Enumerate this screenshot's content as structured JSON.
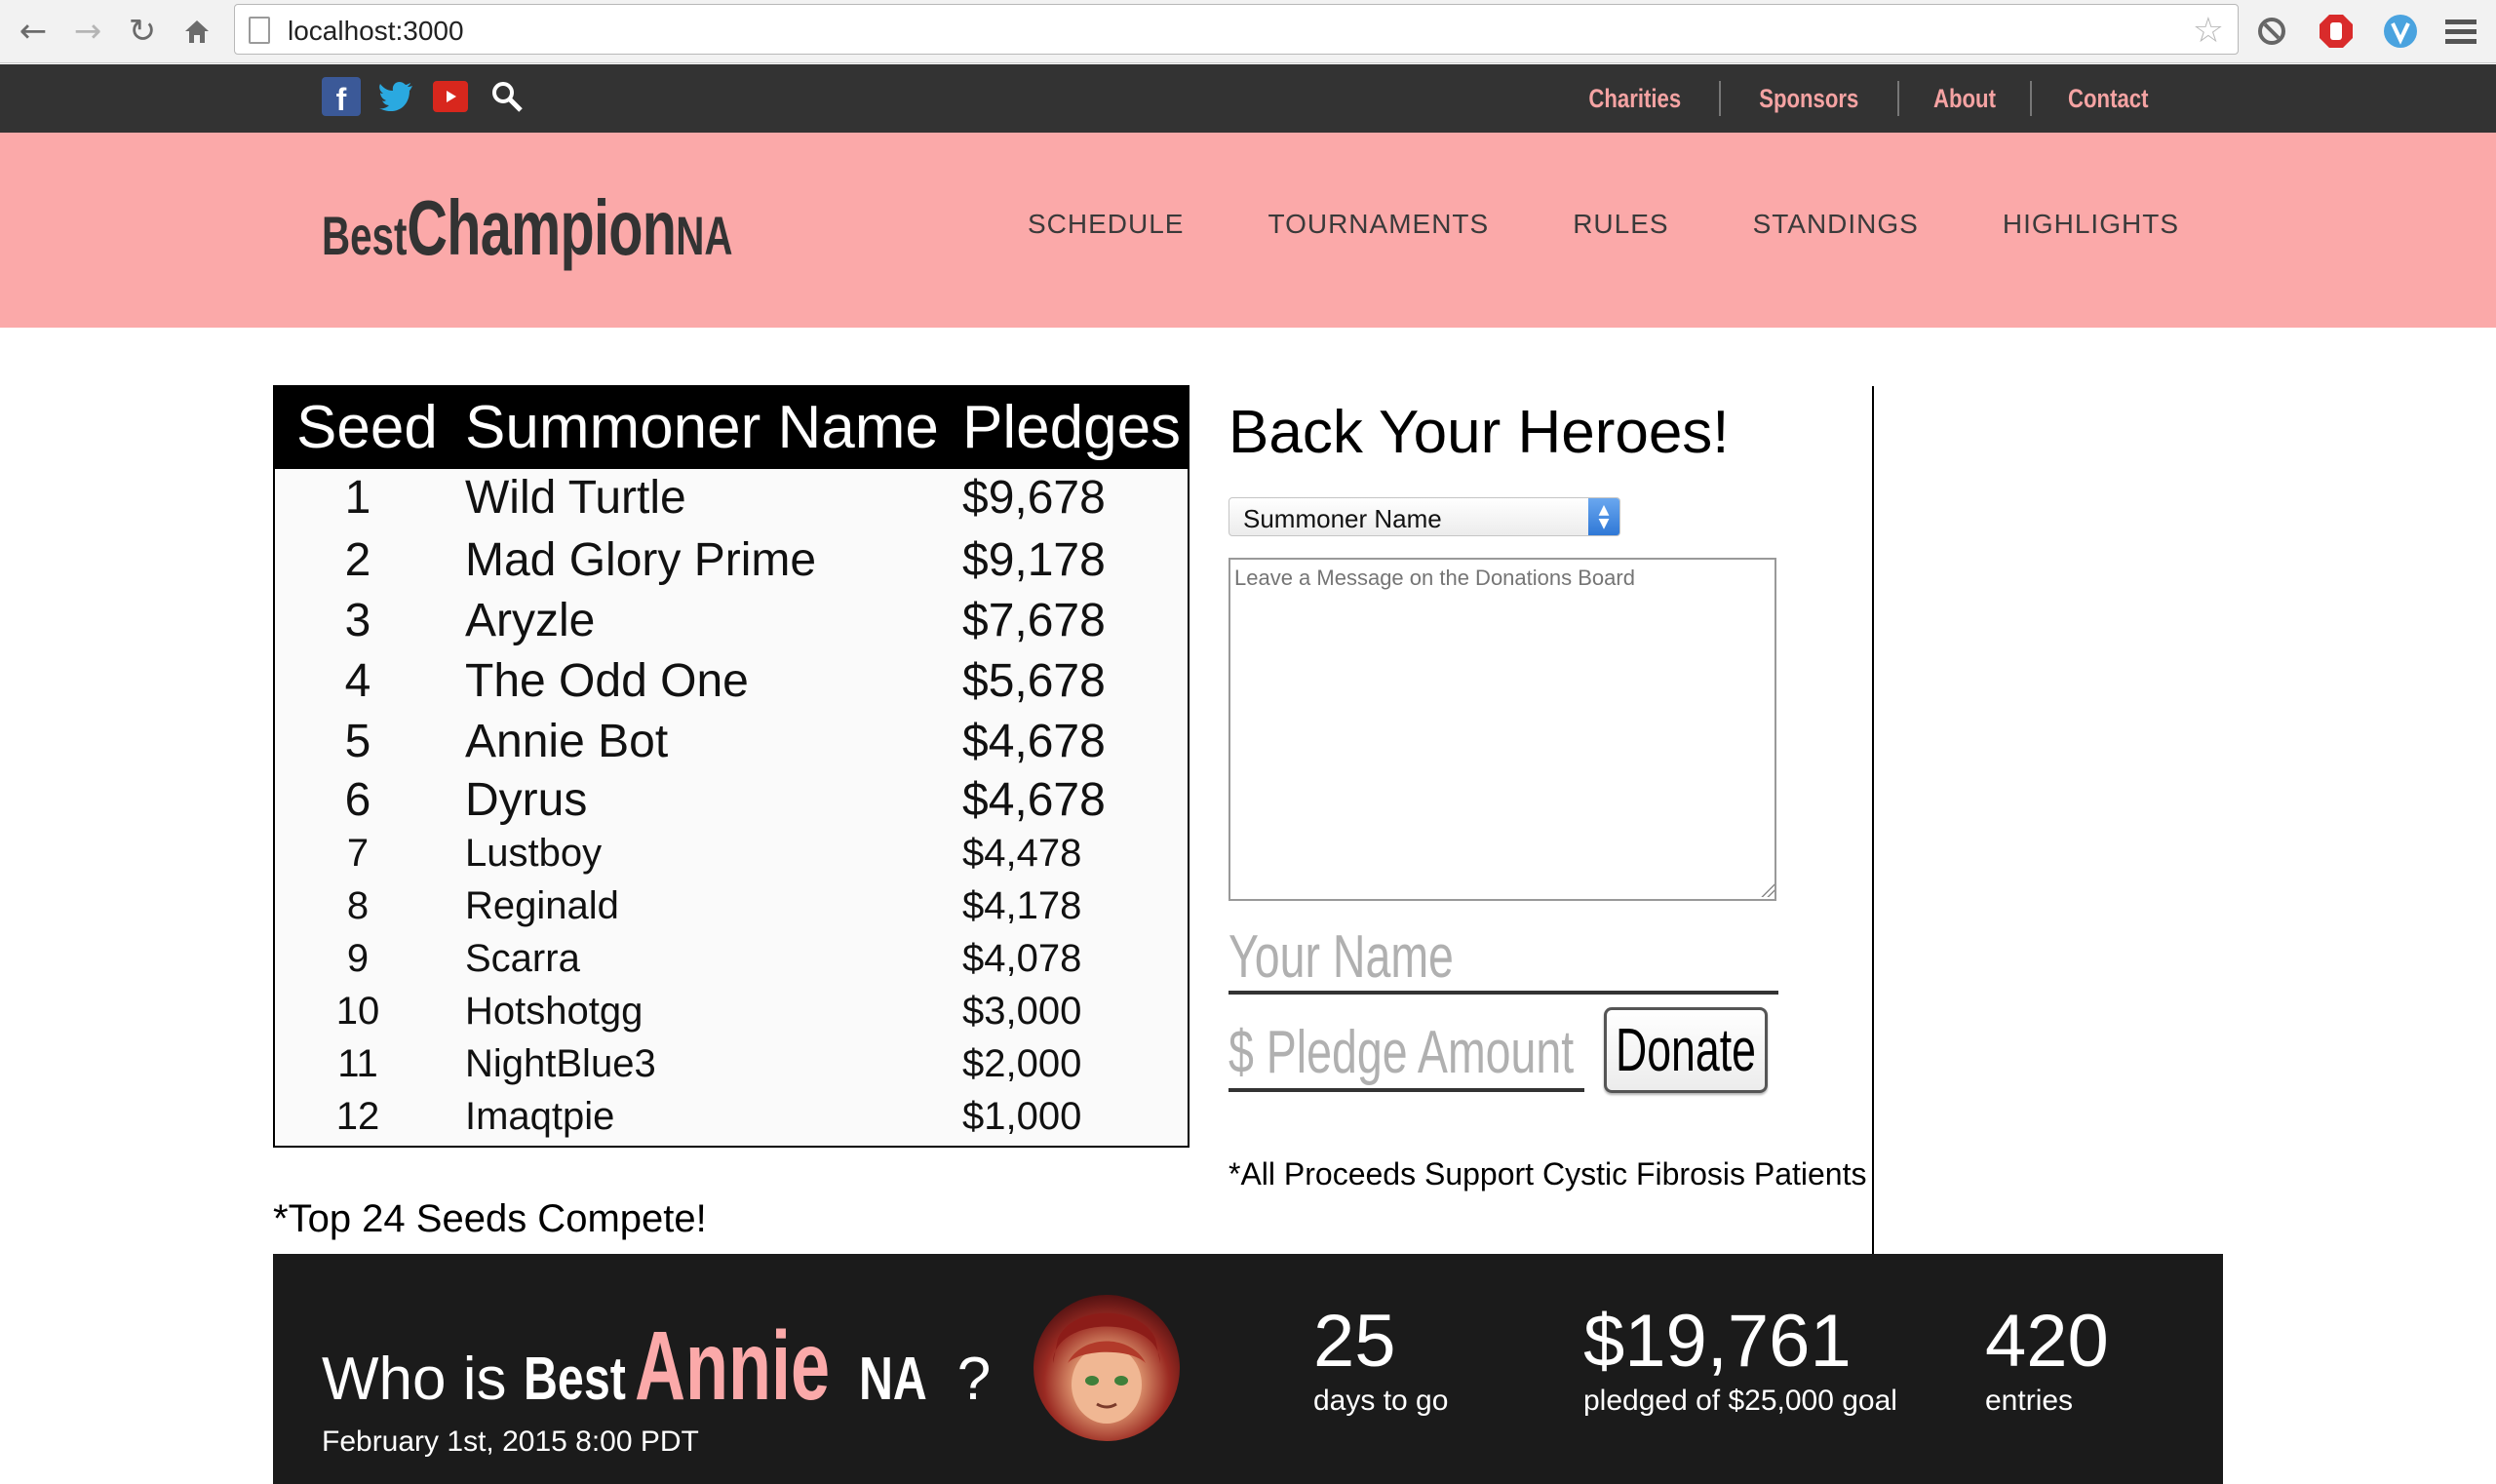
{
  "browser": {
    "url": "localhost:3000"
  },
  "topbar": {
    "social": [
      "facebook-icon",
      "twitter-icon",
      "youtube-icon",
      "search-icon"
    ],
    "links": [
      "Charities",
      "Sponsors",
      "About",
      "Contact"
    ]
  },
  "header": {
    "logo_best": "Best",
    "logo_champion": "Champion",
    "logo_na": "NA",
    "nav": [
      "SCHEDULE",
      "TOURNAMENTS",
      "RULES",
      "STANDINGS",
      "HIGHLIGHTS"
    ]
  },
  "standings": {
    "columns": [
      "Seed",
      "Summoner Name",
      "Pledges"
    ],
    "rows": [
      {
        "seed": "1",
        "name": "Wild Turtle",
        "pledge": "$9,678"
      },
      {
        "seed": "2",
        "name": "Mad Glory Prime",
        "pledge": "$9,178"
      },
      {
        "seed": "3",
        "name": "Aryzle",
        "pledge": "$7,678"
      },
      {
        "seed": "4",
        "name": "The Odd One",
        "pledge": "$5,678"
      },
      {
        "seed": "5",
        "name": "Annie Bot",
        "pledge": "$4,678"
      },
      {
        "seed": "6",
        "name": "Dyrus",
        "pledge": "$4,678"
      },
      {
        "seed": "7",
        "name": "Lustboy",
        "pledge": "$4,478"
      },
      {
        "seed": "8",
        "name": "Reginald",
        "pledge": "$4,178"
      },
      {
        "seed": "9",
        "name": "Scarra",
        "pledge": "$4,078"
      },
      {
        "seed": "10",
        "name": "Hotshotgg",
        "pledge": "$3,000"
      },
      {
        "seed": "11",
        "name": "NightBlue3",
        "pledge": "$2,000"
      },
      {
        "seed": "12",
        "name": "Imaqtpie",
        "pledge": "$1,000"
      }
    ],
    "note": "*Top 24 Seeds Compete!"
  },
  "donate": {
    "title": "Back Your Heroes!",
    "select_value": "Summoner Name",
    "message_placeholder": "Leave a Message on the Donations Board",
    "name_placeholder": "Your Name",
    "pledge_placeholder": "$ Pledge Amount",
    "button": "Donate",
    "proceeds": "*All Proceeds Support Cystic Fibrosis Patients"
  },
  "banner": {
    "who_prefix": "Who is ",
    "who_best": "Best",
    "who_annie": "Annie",
    "who_na": "NA",
    "who_suffix": " ?",
    "date": "February 1st, 2015 8:00 PDT",
    "stats": [
      {
        "value": "25",
        "label": "days to go"
      },
      {
        "value": "$19,761",
        "label": "pledged of $25,000 goal"
      },
      {
        "value": "420",
        "label": "entries"
      }
    ]
  },
  "colors": {
    "pink": "#fba9a9",
    "dark": "#333333",
    "banner": "#1b1b1b"
  }
}
